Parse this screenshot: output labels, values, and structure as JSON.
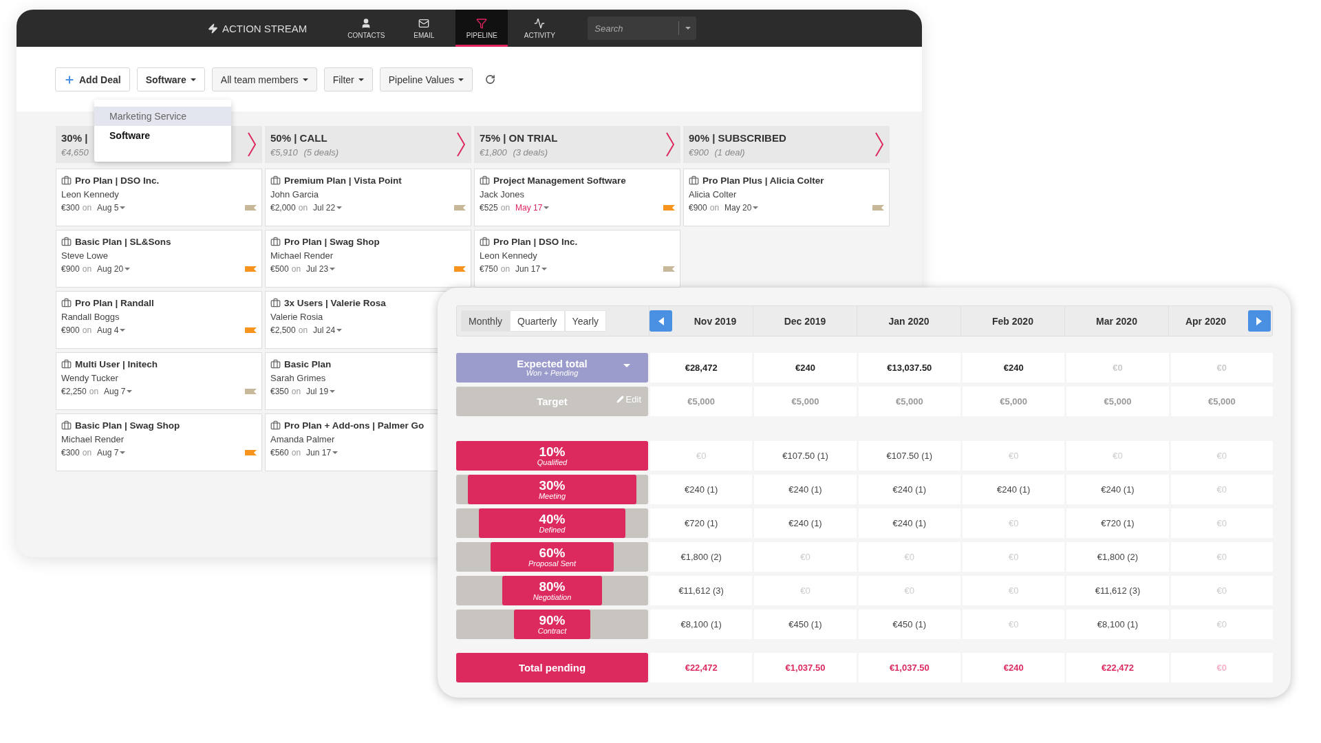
{
  "nav": {
    "brand": "ACTION STREAM",
    "tabs": [
      {
        "label": "CONTACTS",
        "kind": "contacts",
        "selected": false
      },
      {
        "label": "EMAIL",
        "kind": "email",
        "selected": false
      },
      {
        "label": "PIPELINE",
        "kind": "pipeline",
        "selected": true
      },
      {
        "label": "ACTIVITY",
        "kind": "activity",
        "selected": false
      }
    ],
    "search": {
      "placeholder": "Search"
    }
  },
  "toolbar": {
    "add_deal": "Add Deal",
    "dropdowns": [
      {
        "label": "Software",
        "bold": true
      },
      {
        "label": "All team members",
        "bold": false
      },
      {
        "label": "Filter",
        "bold": false
      },
      {
        "label": "Pipeline Values",
        "bold": false
      }
    ]
  },
  "product_menu": [
    {
      "label": "Marketing Service",
      "highlighted": true,
      "selected": false
    },
    {
      "label": "Software",
      "highlighted": false,
      "selected": true
    }
  ],
  "stages": [
    {
      "title": "30% |",
      "amount": "€4,650",
      "cards": [
        {
          "title": "Pro Plan | DSO Inc.",
          "person": "Leon Kennedy",
          "amount": "€300",
          "on": "on",
          "date": "Aug 5",
          "overdue": false,
          "color": "#c8b89a"
        },
        {
          "title": "Basic Plan | SL&Sons",
          "person": "Steve Lowe",
          "amount": "€900",
          "on": "on",
          "date": "Aug 20",
          "overdue": false,
          "color": "#f7941d"
        },
        {
          "title": "Pro Plan | Randall",
          "person": "Randall Boggs",
          "amount": "€900",
          "on": "on",
          "date": "Aug 4",
          "overdue": false,
          "color": "#f7941d"
        },
        {
          "title": "Multi User | Initech",
          "person": "Wendy Tucker",
          "amount": "€2,250",
          "on": "on",
          "date": "Aug 7",
          "overdue": false,
          "color": "#c8b89a"
        },
        {
          "title": "Basic Plan | Swag Shop",
          "person": "Michael Render",
          "amount": "€300",
          "on": "on",
          "date": "Aug 7",
          "overdue": false,
          "color": "#f7941d"
        }
      ]
    },
    {
      "title": "50% | CALL",
      "amount": "€5,910",
      "count": "(5 deals)",
      "cards": [
        {
          "title": "Premium Plan | Vista Point",
          "person": "John Garcia",
          "amount": "€2,000",
          "on": "on",
          "date": "Jul 22",
          "overdue": false,
          "color": "#c8b89a"
        },
        {
          "title": "Pro Plan | Swag Shop",
          "person": "Michael Render",
          "amount": "€500",
          "on": "on",
          "date": "Jul 23",
          "overdue": false,
          "color": "#f7941d"
        },
        {
          "title": "3x Users | Valerie Rosa",
          "person": "Valerie Rosia",
          "amount": "€2,500",
          "on": "on",
          "date": "Jul 24",
          "overdue": false
        },
        {
          "title": "Basic Plan",
          "person": "Sarah Grimes",
          "amount": "€350",
          "on": "on",
          "date": "Jul 19",
          "overdue": false
        },
        {
          "title": "Pro Plan + Add-ons | Palmer Go",
          "person": "Amanda Palmer",
          "amount": "€560",
          "on": "on",
          "date": "Jun 17",
          "overdue": false
        }
      ]
    },
    {
      "title": "75% | ON TRIAL",
      "amount": "€1,800",
      "count": "(3 deals)",
      "cards": [
        {
          "title": "Project Management Software",
          "person": "Jack Jones",
          "amount": "€525",
          "on": "on",
          "date": "May 17",
          "overdue": true,
          "color": "#f7941d"
        },
        {
          "title": "Pro Plan | DSO Inc.",
          "person": "Leon Kennedy",
          "amount": "€750",
          "on": "on",
          "date": "Jun 17",
          "overdue": false,
          "color": "#c8b89a"
        }
      ]
    },
    {
      "title": "90% | SUBSCRIBED",
      "amount": "€900",
      "count": "(1 deal)",
      "cards": [
        {
          "title": "Pro Plan Plus | Alicia Colter",
          "person": "Alicia Colter",
          "amount": "€900",
          "on": "on",
          "date": "May 20",
          "overdue": false,
          "color": "#c8b89a"
        }
      ]
    }
  ],
  "forecast": {
    "periods": [
      {
        "label": "Monthly",
        "selected": true
      },
      {
        "label": "Quarterly",
        "selected": false
      },
      {
        "label": "Yearly",
        "selected": false
      }
    ],
    "months": [
      "Nov 2019",
      "Dec 2019",
      "Jan 2020",
      "Feb 2020",
      "Mar 2020",
      "Apr 2020"
    ],
    "expected": {
      "label": "Expected total",
      "sublabel": "Won + Pending",
      "values": [
        {
          "text": "€28,472",
          "empty": false
        },
        {
          "text": "€240",
          "empty": false
        },
        {
          "text": "€13,037.50",
          "empty": false
        },
        {
          "text": "€240",
          "empty": false
        },
        {
          "text": "€0",
          "empty": true
        },
        {
          "text": "€0",
          "empty": true
        }
      ]
    },
    "target": {
      "label": "Target",
      "edit": "Edit",
      "values": [
        {
          "text": "€5,000",
          "empty": false
        },
        {
          "text": "€5,000",
          "empty": false
        },
        {
          "text": "€5,000",
          "empty": false
        },
        {
          "text": "€5,000",
          "empty": false
        },
        {
          "text": "€5,000",
          "empty": false
        },
        {
          "text": "€5,000",
          "empty": false
        }
      ]
    },
    "stages": [
      {
        "percent": "10%",
        "name": "Qualified",
        "values": [
          {
            "text": "€0",
            "empty": true
          },
          {
            "text": "€107.50 (1)",
            "empty": false
          },
          {
            "text": "€107.50 (1)",
            "empty": false
          },
          {
            "text": "€0",
            "empty": true
          },
          {
            "text": "€0",
            "empty": true
          },
          {
            "text": "€0",
            "empty": true
          }
        ]
      },
      {
        "percent": "30%",
        "name": "Meeting",
        "values": [
          {
            "text": "€240 (1)",
            "empty": false
          },
          {
            "text": "€240 (1)",
            "empty": false
          },
          {
            "text": "€240 (1)",
            "empty": false
          },
          {
            "text": "€240 (1)",
            "empty": false
          },
          {
            "text": "€240 (1)",
            "empty": false
          },
          {
            "text": "€0",
            "empty": true
          }
        ]
      },
      {
        "percent": "40%",
        "name": "Defined",
        "values": [
          {
            "text": "€720 (1)",
            "empty": false
          },
          {
            "text": "€240 (1)",
            "empty": false
          },
          {
            "text": "€240 (1)",
            "empty": false
          },
          {
            "text": "€0",
            "empty": true
          },
          {
            "text": "€720 (1)",
            "empty": false
          },
          {
            "text": "€0",
            "empty": true
          }
        ]
      },
      {
        "percent": "60%",
        "name": "Proposal Sent",
        "values": [
          {
            "text": "€1,800 (2)",
            "empty": false
          },
          {
            "text": "€0",
            "empty": true
          },
          {
            "text": "€0",
            "empty": true
          },
          {
            "text": "€0",
            "empty": true
          },
          {
            "text": "€1,800 (2)",
            "empty": false
          },
          {
            "text": "€0",
            "empty": true
          }
        ]
      },
      {
        "percent": "80%",
        "name": "Negotiation",
        "values": [
          {
            "text": "€11,612 (3)",
            "empty": false
          },
          {
            "text": "€0",
            "empty": true
          },
          {
            "text": "€0",
            "empty": true
          },
          {
            "text": "€0",
            "empty": true
          },
          {
            "text": "€11,612 (3)",
            "empty": false
          },
          {
            "text": "€0",
            "empty": true
          }
        ]
      },
      {
        "percent": "90%",
        "name": "Contract",
        "values": [
          {
            "text": "€8,100 (1)",
            "empty": false
          },
          {
            "text": "€450 (1)",
            "empty": false
          },
          {
            "text": "€450 (1)",
            "empty": false
          },
          {
            "text": "€0",
            "empty": true
          },
          {
            "text": "€8,100 (1)",
            "empty": false
          },
          {
            "text": "€0",
            "empty": true
          }
        ]
      }
    ],
    "total": {
      "label": "Total pending",
      "values": [
        {
          "text": "€22,472",
          "empty": false
        },
        {
          "text": "€1,037.50",
          "empty": false
        },
        {
          "text": "€1,037.50",
          "empty": false
        },
        {
          "text": "€240",
          "empty": false
        },
        {
          "text": "€22,472",
          "empty": false
        },
        {
          "text": "€0",
          "empty": true
        }
      ]
    }
  }
}
